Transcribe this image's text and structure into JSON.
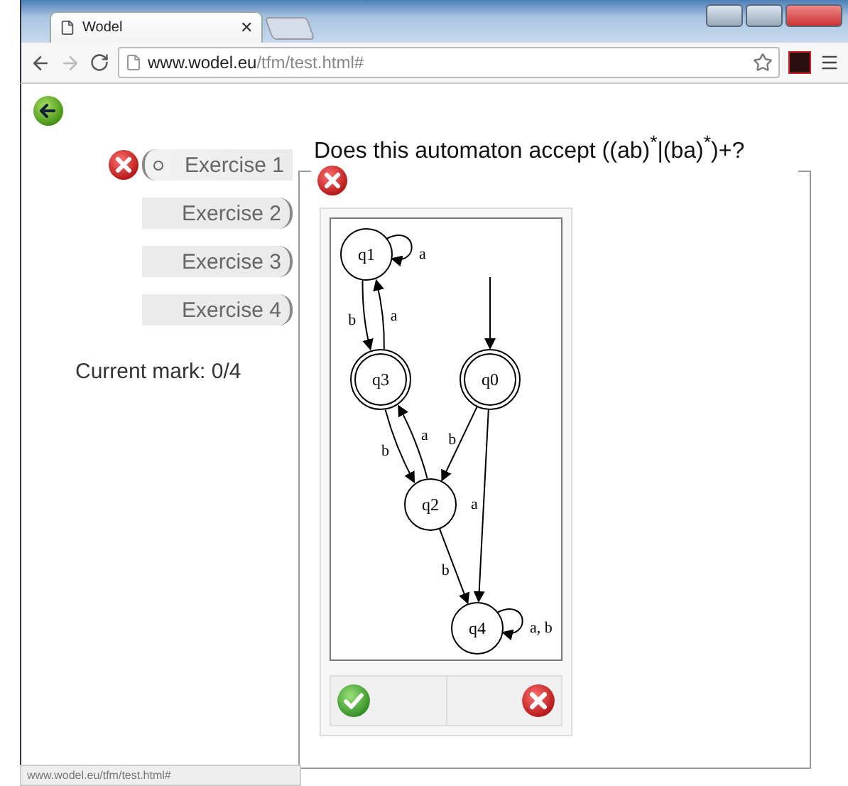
{
  "browser": {
    "tab_title": "Wodel",
    "url_host": "www.wodel.eu",
    "url_path": "/tfm/test.html#",
    "tab_close": "✕"
  },
  "exercises": [
    {
      "label": "Exercise 1",
      "selected": true,
      "wrong": true
    },
    {
      "label": "Exercise 2",
      "selected": false,
      "wrong": false
    },
    {
      "label": "Exercise 3",
      "selected": false,
      "wrong": false
    },
    {
      "label": "Exercise 4",
      "selected": false,
      "wrong": false
    }
  ],
  "current_mark": "Current mark: 0/4",
  "question": "Does this automaton accept ((ab)$^{*}$|(ba)$^{*}$)+?",
  "answer_wrong": true,
  "automaton": {
    "states": [
      {
        "label": "q1",
        "accepting": false,
        "initial": false
      },
      {
        "label": "q3",
        "accepting": true,
        "initial": false
      },
      {
        "label": "q0",
        "accepting": true,
        "initial": true
      },
      {
        "label": "q2",
        "accepting": false,
        "initial": false
      },
      {
        "label": "q4",
        "accepting": false,
        "initial": false
      }
    ],
    "transitions": [
      {
        "label": "a"
      },
      {
        "label": "b"
      },
      {
        "label": "a"
      },
      {
        "label": "b"
      },
      {
        "label": "a"
      },
      {
        "label": "b"
      },
      {
        "label": "a"
      },
      {
        "label": "b"
      },
      {
        "label": "a, b"
      }
    ]
  },
  "status_bar": "www.wodel.eu/tfm/test.html#"
}
